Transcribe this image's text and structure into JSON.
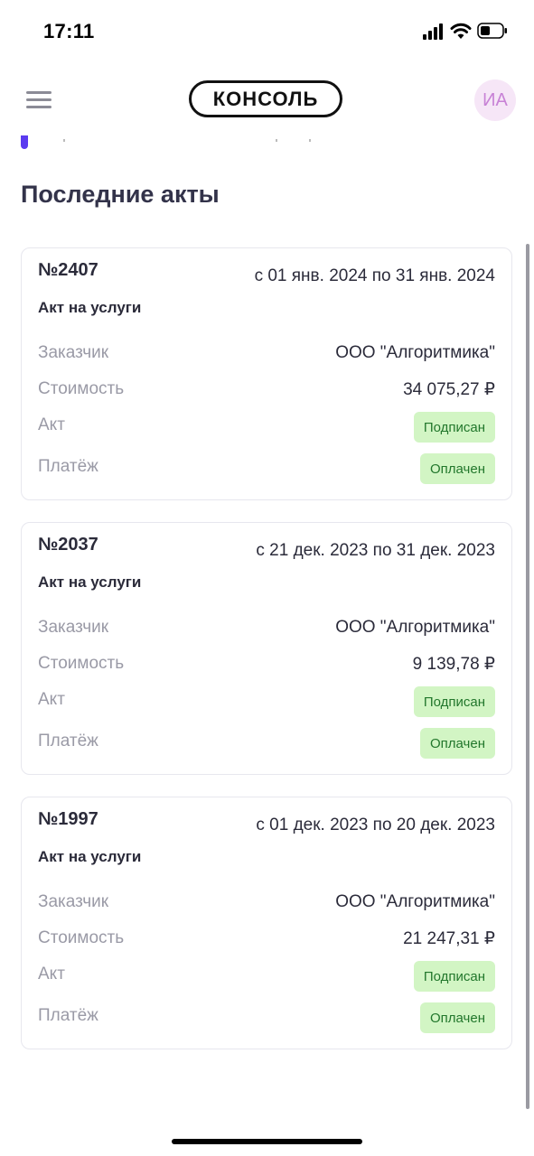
{
  "status_bar": {
    "time": "17:11"
  },
  "header": {
    "menu_icon": "hamburger-icon",
    "logo_text": "КОНСОЛЬ",
    "avatar_initials": "ИА"
  },
  "section": {
    "title": "Последние акты"
  },
  "labels": {
    "customer": "Заказчик",
    "cost": "Стоимость",
    "act": "Акт",
    "payment": "Платёж"
  },
  "acts": [
    {
      "number": "№2407",
      "period": "с 01 янв. 2024  по 31 янв. 2024",
      "type": "Акт на услуги",
      "customer": "ООО \"Алгоритмика\"",
      "cost": "34 075,27 ₽",
      "act_status": "Подписан",
      "payment_status": "Оплачен"
    },
    {
      "number": "№2037",
      "period": "с 21 дек. 2023 по 31 дек. 2023",
      "type": "Акт на услуги",
      "customer": "ООО \"Алгоритмика\"",
      "cost": "9 139,78 ₽",
      "act_status": "Подписан",
      "payment_status": "Оплачен"
    },
    {
      "number": "№1997",
      "period": "с 01 дек. 2023 по 20 дек. 2023",
      "type": "Акт на услуги",
      "customer": "ООО \"Алгоритмика\"",
      "cost": "21 247,31 ₽",
      "act_status": "Подписан",
      "payment_status": "Оплачен"
    }
  ],
  "colors": {
    "accent": "#5b3bf0",
    "badge_bg": "#d2f5c4",
    "badge_text": "#22772c",
    "avatar_bg": "#f6e6f7"
  }
}
